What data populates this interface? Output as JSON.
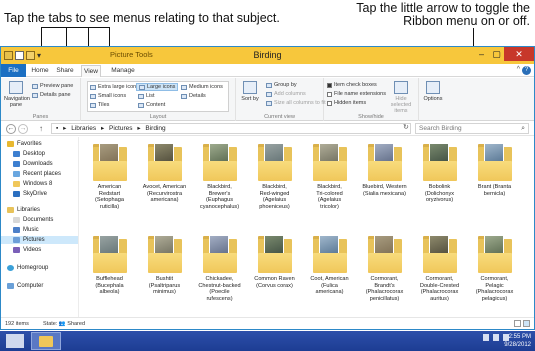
{
  "callouts": {
    "left": "Tap the tabs to see menus relating to that subject.",
    "right_line1": "Tap the little arrow to toggle the",
    "right_line2": "Ribbon menu on or off."
  },
  "window": {
    "title": "Birding",
    "contextual_tab_group": "Picture Tools",
    "controls": [
      "–",
      "▢",
      "✕"
    ]
  },
  "tabs": {
    "file": "File",
    "home": "Home",
    "share": "Share",
    "view": "View",
    "manage": "Manage",
    "toggle_arrow": "^",
    "help": "?"
  },
  "ribbon": {
    "panes": {
      "label": "Panes",
      "navigation_pane": "Navigation pane",
      "preview_pane": "Preview pane",
      "details_pane": "Details pane"
    },
    "layout": {
      "label": "Layout",
      "items": [
        "Extra large icons",
        "Large icons",
        "Medium icons",
        "Small icons",
        "List",
        "Details",
        "Tiles",
        "Content"
      ]
    },
    "current_view": {
      "label": "Current view",
      "sort_by": "Sort by",
      "group_by": "Group by",
      "add_columns": "Add columns",
      "size_columns": "Size all columns to fit"
    },
    "show_hide": {
      "label": "Show/hide",
      "item_check_boxes": "Item check boxes",
      "file_name_extensions": "File name extensions",
      "hidden_items": "Hidden items",
      "hide_selected": "Hide selected items"
    },
    "options": "Options"
  },
  "address": {
    "crumbs": [
      "Libraries",
      "Pictures",
      "Birding"
    ],
    "separator": "▸",
    "search_placeholder": "Search Birding"
  },
  "nav_pane": {
    "favorites": "Favorites",
    "favorites_items": [
      "Desktop",
      "Downloads",
      "Recent places",
      "Windows 8",
      "SkyDrive"
    ],
    "libraries": "Libraries",
    "libraries_items": [
      "Documents",
      "Music",
      "Pictures",
      "Videos"
    ],
    "homegroup": "Homegroup",
    "computer": "Computer"
  },
  "folders": [
    {
      "lines": [
        "American",
        "Redstart",
        "(Setophaga",
        "ruticilla)"
      ]
    },
    {
      "lines": [
        "Avocet, American",
        "(Recurvirostra",
        "americana)"
      ]
    },
    {
      "lines": [
        "Blackbird,",
        "Brewer's",
        "(Euphagus",
        "cyanocephalus)"
      ]
    },
    {
      "lines": [
        "Blackbird,",
        "Red-winged",
        "(Agelaius",
        "phoeniceus)"
      ]
    },
    {
      "lines": [
        "Blackbird,",
        "Tri-colored",
        "(Agelaius",
        "tricolor)"
      ]
    },
    {
      "lines": [
        "Bluebird, Western",
        "(Sialia mexicana)"
      ]
    },
    {
      "lines": [
        "Bobolink",
        "(Dolichonyx",
        "oryzivorus)"
      ]
    },
    {
      "lines": [
        "Brant (Branta",
        "bernicla)"
      ]
    },
    {
      "lines": [
        "Bufflehead",
        "(Bucephala",
        "albeola)"
      ]
    },
    {
      "lines": [
        "Bushtit",
        "(Psaltriparus",
        "minimus)"
      ]
    },
    {
      "lines": [
        "Chickadee,",
        "Chestnut-backed",
        "(Poecile",
        "rufescens)"
      ]
    },
    {
      "lines": [
        "Common Raven",
        "(Corvus corax)"
      ]
    },
    {
      "lines": [
        "Coot, American",
        "(Fulica",
        "americana)"
      ]
    },
    {
      "lines": [
        "Cormorant,",
        "Brandt's",
        "(Phalacrocorax",
        "penicillatus)"
      ]
    },
    {
      "lines": [
        "Cormorant,",
        "Double-Crested",
        "(Phalacrocorax",
        "auritus)"
      ]
    },
    {
      "lines": [
        "Cormorant,",
        "Pelagic",
        "(Phalacrocorax",
        "pelagicus)"
      ]
    }
  ],
  "status": {
    "item_count": "192 items",
    "state": "State: 👥 Shared"
  },
  "taskbar": {
    "time": "2:55 PM",
    "date": "9/28/2012"
  },
  "colors": {
    "titlebar": "#f7c73c",
    "file_tab": "#1b6fc2",
    "taskbar": "#2d4faa",
    "folder": "#f0c75a"
  }
}
